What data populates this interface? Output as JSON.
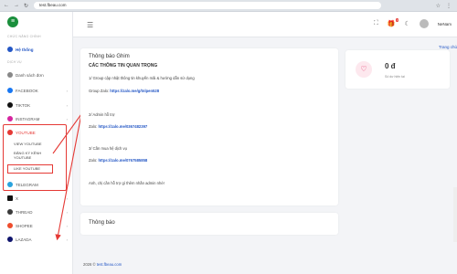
{
  "browser": {
    "url": "test.fbeau.com",
    "nav": [
      "←",
      "→",
      "↻"
    ]
  },
  "sidebar": {
    "section_main": "CHỨC NĂNG CHÍNH",
    "system": "Hệ thống",
    "section_services": "DỊCH VỤ",
    "orders": "Danh sách đơn",
    "facebook": "FACEBOOK",
    "tiktok": "TIKTOK",
    "instagram": "INSTAGRAM",
    "youtube": "YOUTUBE",
    "yt_view": "VIEW YOUTUBE",
    "yt_sub": "ĐĂNG KÝ KÊNH YOUTUBE",
    "yt_like": "LIKE YOUTUBE",
    "telegram": "TELEGRAM",
    "x": "X",
    "thread": "THREAD",
    "shopee": "SHOPEE",
    "lazada": "LAZADA"
  },
  "topbar": {
    "username": "NeNam",
    "badge": "3"
  },
  "breadcrumb": "Trang chủ",
  "pinned": {
    "title": "Thông báo Ghim",
    "heading": "CÁC THÔNG TIN QUAN TRỌNG",
    "l1": "1/ Group cập nhật thông tin khuyến mãi & hướng dẫn sử dụng",
    "l2_label": "Group Zalo:",
    "l2_link": "https://zalo.me/g/tnlpen528",
    "l3": "2/ Admin hỗ trợ",
    "l4_label": "Zalo:",
    "l4_link": "https://zalo.me/0367482397",
    "l5": "3/ Cần mua hệ dịch vụ",
    "l6_label": "Zalo:",
    "l6_link": "https://zalo.me/0767585858",
    "l7": "Anh, chị cần hỗ trợ gì thêm nhắn admin nhé!"
  },
  "notice": {
    "title": "Thông báo"
  },
  "balance": {
    "value": "0 đ",
    "label": "Số dư hiện tại"
  },
  "footer": {
    "prefix": "2026 ©",
    "brand": "test.fbeau.com"
  }
}
